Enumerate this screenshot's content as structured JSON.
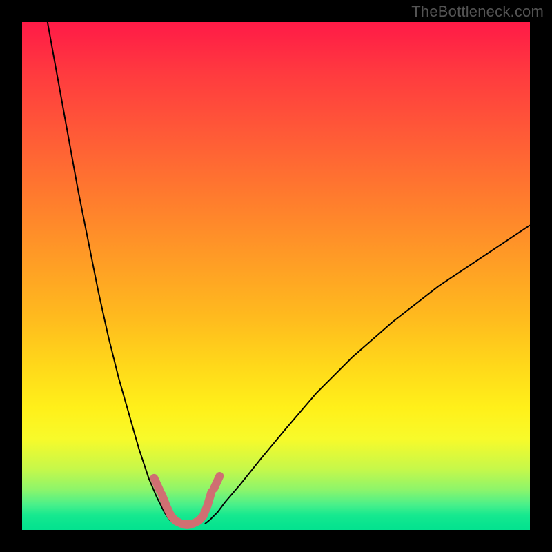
{
  "watermark": "TheBottleneck.com",
  "chart_data": {
    "type": "line",
    "title": "",
    "xlabel": "",
    "ylabel": "",
    "xlim": [
      0,
      100
    ],
    "ylim": [
      0,
      100
    ],
    "grid": false,
    "legend": false,
    "gradient_stops": [
      {
        "pct": 0,
        "color": "#ff1a47"
      },
      {
        "pct": 10,
        "color": "#ff3a3f"
      },
      {
        "pct": 22,
        "color": "#ff5a37"
      },
      {
        "pct": 34,
        "color": "#ff7a2e"
      },
      {
        "pct": 46,
        "color": "#ff9a26"
      },
      {
        "pct": 58,
        "color": "#ffba1e"
      },
      {
        "pct": 68,
        "color": "#ffd91a"
      },
      {
        "pct": 76,
        "color": "#fff01a"
      },
      {
        "pct": 82,
        "color": "#f8fa2a"
      },
      {
        "pct": 88,
        "color": "#c6f84a"
      },
      {
        "pct": 92,
        "color": "#8ef56a"
      },
      {
        "pct": 95,
        "color": "#4af08a"
      },
      {
        "pct": 97,
        "color": "#18e98f"
      },
      {
        "pct": 98,
        "color": "#0fe68f"
      },
      {
        "pct": 99,
        "color": "#08e48f"
      },
      {
        "pct": 100,
        "color": "#04e28f"
      }
    ],
    "series": [
      {
        "name": "curve-left",
        "stroke": "#000000",
        "stroke_width": 2,
        "x": [
          5,
          7,
          9,
          11,
          13,
          15,
          17,
          19,
          21,
          23,
          25,
          26.5,
          28,
          29,
          30
        ],
        "y": [
          100,
          89,
          78,
          67,
          57,
          47,
          38,
          30,
          23,
          16,
          10,
          6.5,
          3.5,
          2,
          1.2
        ]
      },
      {
        "name": "curve-right",
        "stroke": "#000000",
        "stroke_width": 2,
        "x": [
          36,
          37,
          38.5,
          40,
          43,
          47,
          52,
          58,
          65,
          73,
          82,
          91,
          100
        ],
        "y": [
          1.2,
          2,
          3.5,
          5.5,
          9,
          14,
          20,
          27,
          34,
          41,
          48,
          54,
          60
        ]
      },
      {
        "name": "marker-band",
        "stroke": "#cf6f72",
        "stroke_width": 12,
        "linecap": "round",
        "x": [
          27.5,
          28.5,
          29.3,
          30.2,
          31.3,
          32.5,
          33.7,
          34.8,
          35.7,
          36.5,
          37.3
        ],
        "y": [
          7.0,
          4.5,
          2.8,
          1.8,
          1.25,
          1.1,
          1.25,
          1.8,
          2.8,
          4.8,
          7.5
        ]
      },
      {
        "name": "marker-dash-left-upper",
        "stroke": "#cf6f72",
        "stroke_width": 12,
        "linecap": "round",
        "x": [
          26.0,
          27.1
        ],
        "y": [
          10.2,
          7.8
        ]
      },
      {
        "name": "marker-dash-right-upper",
        "stroke": "#cf6f72",
        "stroke_width": 12,
        "linecap": "round",
        "x": [
          37.8,
          38.9
        ],
        "y": [
          8.2,
          10.6
        ]
      }
    ]
  }
}
